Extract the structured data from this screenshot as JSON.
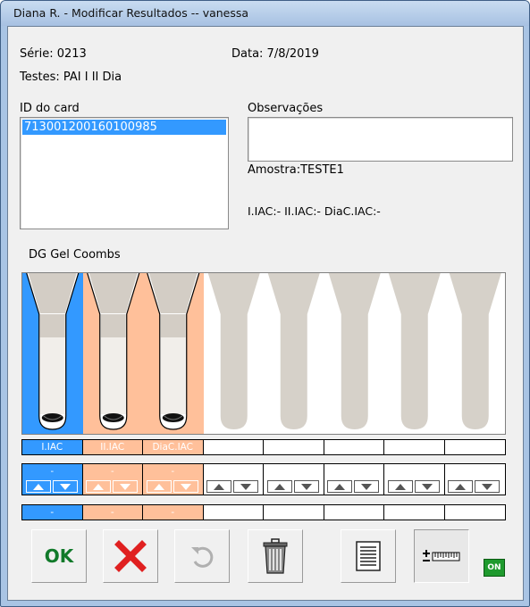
{
  "window": {
    "title": "Diana R. - Modificar Resultados -- vanessa"
  },
  "header": {
    "serie": "Série: 0213",
    "data": "Data: 7/8/2019",
    "testes": "Testes: PAI I II Dia"
  },
  "card_list": {
    "label": "ID do card",
    "items": [
      "713001200160100985"
    ]
  },
  "observacoes": {
    "label": "Observações",
    "value": ""
  },
  "amostra": "Amostra:TESTE1",
  "results_summary": "I.IAC:-   II.IAC:-   DiaC.IAC:-",
  "card": {
    "name": "DG Gel Coombs",
    "columns": [
      {
        "label": "I.IAC",
        "value": "-",
        "bg": "#3399ff",
        "active": true
      },
      {
        "label": "II.IAC",
        "value": "-",
        "bg": "#ffc09a",
        "active": true
      },
      {
        "label": "DiaC.IAC",
        "value": "-",
        "bg": "#ffc09a",
        "active": true
      },
      {
        "label": "",
        "value": "",
        "bg": "#ffffff",
        "active": false
      },
      {
        "label": "",
        "value": "",
        "bg": "#ffffff",
        "active": false
      },
      {
        "label": "",
        "value": "",
        "bg": "#ffffff",
        "active": false
      },
      {
        "label": "",
        "value": "",
        "bg": "#ffffff",
        "active": false
      },
      {
        "label": "",
        "value": "",
        "bg": "#ffffff",
        "active": false
      }
    ]
  },
  "toolbar": {
    "ok": "OK",
    "on": "ON"
  },
  "colors": {
    "accent": "#3399ff",
    "tube_active_bg": "#ffc09a",
    "tube_inactive": "#d6d1c9"
  },
  "icons": [
    "ok-icon",
    "cancel-x-icon",
    "undo-icon",
    "trash-icon",
    "report-icon",
    "plus-minus-scale-icon",
    "on-indicator-icon"
  ]
}
